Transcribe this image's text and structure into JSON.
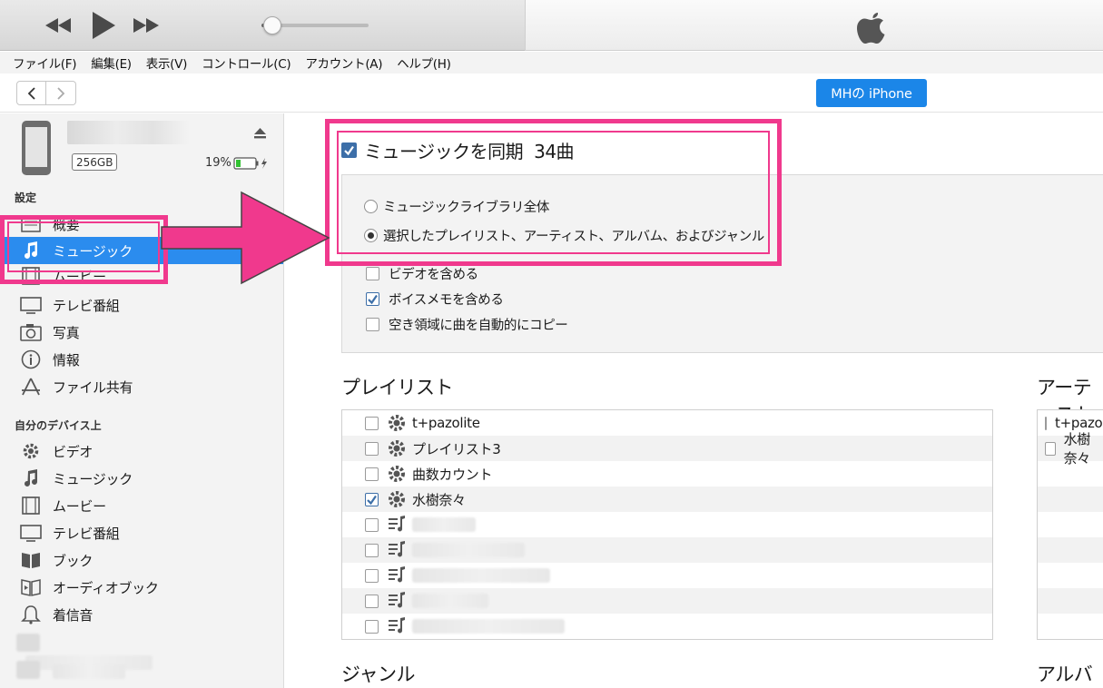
{
  "player": {
    "rewind_icon": "rewind-icon",
    "play_icon": "play-icon",
    "fast_forward_icon": "fast-forward-icon",
    "volume_level": 0.1
  },
  "menu": [
    "ファイル(F)",
    "編集(E)",
    "表示(V)",
    "コントロール(C)",
    "アカウント(A)",
    "ヘルプ(H)"
  ],
  "device_button": "MHの iPhone",
  "device": {
    "capacity": "256GB",
    "battery": "19%"
  },
  "sidebar": {
    "settings_label": "設定",
    "settings_items": [
      {
        "label": "概要",
        "icon": "summary-icon"
      },
      {
        "label": "ミュージック",
        "icon": "music-note-icon"
      },
      {
        "label": "ムービー",
        "icon": "film-icon"
      },
      {
        "label": "テレビ番組",
        "icon": "tv-icon"
      },
      {
        "label": "写真",
        "icon": "camera-icon"
      },
      {
        "label": "情報",
        "icon": "info-icon"
      },
      {
        "label": "ファイル共有",
        "icon": "app-store-icon"
      }
    ],
    "mydevice_label": "自分のデバイス上",
    "mydevice_items": [
      {
        "label": "ビデオ",
        "icon": "gear-icon"
      },
      {
        "label": "ミュージック",
        "icon": "music-note-icon"
      },
      {
        "label": "ムービー",
        "icon": "film-icon"
      },
      {
        "label": "テレビ番組",
        "icon": "tv-icon"
      },
      {
        "label": "ブック",
        "icon": "book-icon"
      },
      {
        "label": "オーディオブック",
        "icon": "audiobook-icon"
      },
      {
        "label": "着信音",
        "icon": "bell-icon"
      }
    ]
  },
  "sync": {
    "title": "ミュージックを同期",
    "count": "34曲",
    "checked": true,
    "radio_all": "ミュージックライブラリ全体",
    "radio_selected": "選択したプレイリスト、アーティスト、アルバム、およびジャンル",
    "include_video": "ビデオを含める",
    "include_voice_memos": "ボイスメモを含める",
    "autofill": "空き領域に曲を自動的にコピー"
  },
  "playlists": {
    "title": "プレイリスト",
    "items": [
      {
        "label": "t+pazolite",
        "checked": false,
        "icon": "smart-playlist-gear-icon"
      },
      {
        "label": "プレイリスト3",
        "checked": false,
        "icon": "smart-playlist-gear-icon"
      },
      {
        "label": "曲数カウント",
        "checked": false,
        "icon": "smart-playlist-gear-icon"
      },
      {
        "label": "水樹奈々",
        "checked": true,
        "icon": "smart-playlist-gear-icon"
      }
    ]
  },
  "artists": {
    "title": "アーティスト",
    "items": [
      "t+pazolite",
      "水樹奈々"
    ]
  },
  "genres": {
    "title": "ジャンル"
  },
  "albums": {
    "title": "アルバム"
  },
  "colors": {
    "accent": "#2b8cee",
    "device_button": "#1b86e8",
    "highlight": "#f0398d"
  }
}
